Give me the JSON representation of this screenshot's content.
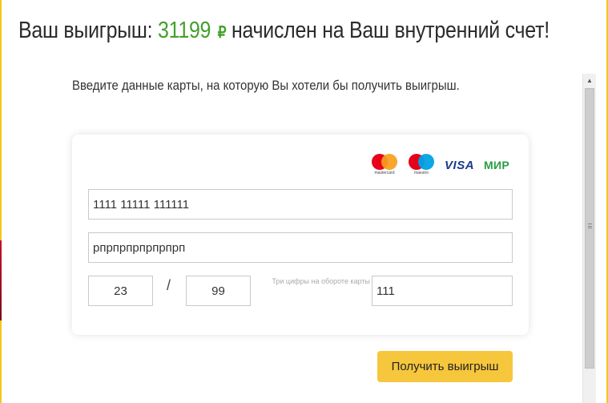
{
  "title": {
    "prefix": "Ваш выигрыш:",
    "amount": "31199",
    "currency": "₽",
    "suffix": "начислен на Ваш внутренний счет!"
  },
  "subtitle": "Введите данные карты, на которую Вы хотели бы получить выигрыш.",
  "payment_logos": {
    "mastercard": "mastercard",
    "maestro": "maestro",
    "visa": "VISA",
    "mir": "МИР"
  },
  "form": {
    "card_number": "1111 11111 111111",
    "card_holder": "рпрпрпрпрпрпрп",
    "exp_month": "23",
    "separator": "/",
    "exp_year": "99",
    "cvv_label": "Три цифры на обороте карты",
    "cvv": "111"
  },
  "submit_label": "Получить выигрыш",
  "colors": {
    "accent_green": "#43a02b",
    "button_yellow": "#f6c63c",
    "page_background": "#f0c91a"
  }
}
